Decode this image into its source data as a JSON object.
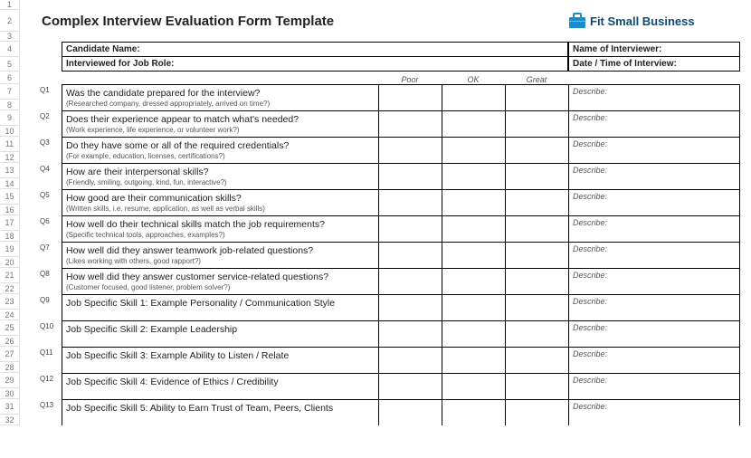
{
  "title": "Complex Interview Evaluation Form Template",
  "logo": {
    "brand": "Fit Small Business"
  },
  "header": {
    "candidate_name": "Candidate Name:",
    "job_role": "Interviewed for Job Role:",
    "interviewer": "Name of Interviewer:",
    "datetime": "Date / Time of Interview:"
  },
  "ratings": {
    "poor": "Poor",
    "ok": "OK",
    "great": "Great"
  },
  "describe": "Describe:",
  "rows": [
    "1",
    "2",
    "3",
    "4",
    "5",
    "6",
    "7",
    "8",
    "9",
    "10",
    "11",
    "12",
    "13",
    "14",
    "15",
    "16",
    "17",
    "18",
    "19",
    "20",
    "21",
    "22",
    "23",
    "24",
    "25",
    "26",
    "27",
    "28",
    "29",
    "30",
    "31",
    "32"
  ],
  "questions": [
    {
      "id": "Q1",
      "text": "Was the candidate prepared for the interview?",
      "sub": "(Researched company, dressed appropriately, arrived on time?)"
    },
    {
      "id": "Q2",
      "text": "Does their experience appear to match what's needed?",
      "sub": "(Work experience, life experience, or volunteer work?)"
    },
    {
      "id": "Q3",
      "text": "Do they have some or all of the required credentials?",
      "sub": "(For example, education, licenses, certifications?)"
    },
    {
      "id": "Q4",
      "text": "How are their interpersonal skills?",
      "sub": "(Friendly, smiling, outgoing, kind, fun, interactive?)"
    },
    {
      "id": "Q5",
      "text": "How good are their communication skills?",
      "sub": "(Written skills, i.e. resume, application, as well as verbal skills)"
    },
    {
      "id": "Q6",
      "text": "How well do their technical skills match the job requirements?",
      "sub": "(Specific technical tools, approaches, examples?)"
    },
    {
      "id": "Q7",
      "text": "How well did they answer teamwork job-related questions?",
      "sub": "(Likes working with others, good rapport?)"
    },
    {
      "id": "Q8",
      "text": "How well did they answer customer service-related questions?",
      "sub": "(Customer focused, good listener, problem solver?)"
    },
    {
      "id": "Q9",
      "text": "Job Specific Skill 1: Example Personality / Communication Style",
      "sub": ""
    },
    {
      "id": "Q10",
      "text": "Job Specific Skill 2: Example Leadership",
      "sub": ""
    },
    {
      "id": "Q11",
      "text": "Job Specific Skill 3: Example Ability to Listen / Relate",
      "sub": ""
    },
    {
      "id": "Q12",
      "text": "Job Specific Skill 4: Evidence of Ethics / Credibility",
      "sub": ""
    },
    {
      "id": "Q13",
      "text": "Job Specific Skill 5: Ability to Earn Trust of Team, Peers, Clients",
      "sub": ""
    }
  ]
}
